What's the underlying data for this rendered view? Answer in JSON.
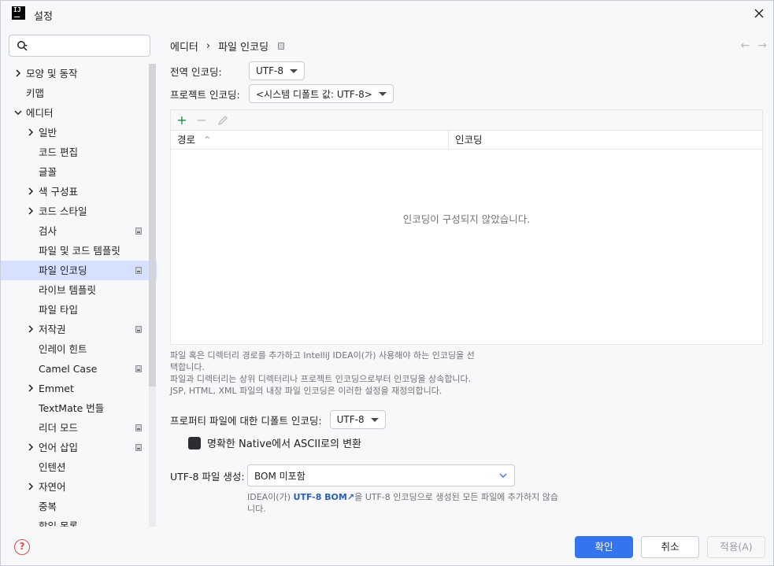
{
  "window": {
    "title": "설정"
  },
  "search": {
    "placeholder": ""
  },
  "sidebar": {
    "items": [
      {
        "label": "모양 및 동작",
        "chevron": "right",
        "indent": 0,
        "project": false,
        "selected": false
      },
      {
        "label": "키맵",
        "chevron": "",
        "indent": 0,
        "project": false,
        "selected": false
      },
      {
        "label": "에디터",
        "chevron": "down",
        "indent": 0,
        "project": false,
        "selected": false
      },
      {
        "label": "일반",
        "chevron": "right",
        "indent": 1,
        "project": false,
        "selected": false
      },
      {
        "label": "코드 편집",
        "chevron": "",
        "indent": 1,
        "project": false,
        "selected": false
      },
      {
        "label": "글꼴",
        "chevron": "",
        "indent": 1,
        "project": false,
        "selected": false
      },
      {
        "label": "색 구성표",
        "chevron": "right",
        "indent": 1,
        "project": false,
        "selected": false
      },
      {
        "label": "코드 스타일",
        "chevron": "right",
        "indent": 1,
        "project": false,
        "selected": false
      },
      {
        "label": "검사",
        "chevron": "",
        "indent": 1,
        "project": true,
        "selected": false
      },
      {
        "label": "파일 및 코드 템플릿",
        "chevron": "",
        "indent": 1,
        "project": false,
        "selected": false
      },
      {
        "label": "파일 인코딩",
        "chevron": "",
        "indent": 1,
        "project": true,
        "selected": true
      },
      {
        "label": "라이브 템플릿",
        "chevron": "",
        "indent": 1,
        "project": false,
        "selected": false
      },
      {
        "label": "파일 타입",
        "chevron": "",
        "indent": 1,
        "project": false,
        "selected": false
      },
      {
        "label": "저작권",
        "chevron": "right",
        "indent": 1,
        "project": true,
        "selected": false
      },
      {
        "label": "인레이 힌트",
        "chevron": "",
        "indent": 1,
        "project": false,
        "selected": false
      },
      {
        "label": "Camel Case",
        "chevron": "",
        "indent": 1,
        "project": true,
        "selected": false
      },
      {
        "label": "Emmet",
        "chevron": "right",
        "indent": 1,
        "project": false,
        "selected": false
      },
      {
        "label": "TextMate 번들",
        "chevron": "",
        "indent": 1,
        "project": false,
        "selected": false
      },
      {
        "label": "리더 모드",
        "chevron": "",
        "indent": 1,
        "project": true,
        "selected": false
      },
      {
        "label": "언어 삽입",
        "chevron": "right",
        "indent": 1,
        "project": true,
        "selected": false
      },
      {
        "label": "인텐션",
        "chevron": "",
        "indent": 1,
        "project": false,
        "selected": false
      },
      {
        "label": "자연어",
        "chevron": "right",
        "indent": 1,
        "project": false,
        "selected": false
      },
      {
        "label": "중복",
        "chevron": "",
        "indent": 1,
        "project": false,
        "selected": false
      },
      {
        "label": "할일 목록",
        "chevron": "",
        "indent": 1,
        "project": false,
        "selected": false
      }
    ]
  },
  "breadcrumb": {
    "parent": "에디터",
    "current": "파일 인코딩"
  },
  "global_encoding": {
    "label": "전역 인코딩:",
    "value": "UTF-8"
  },
  "project_encoding": {
    "label": "프로젝트 인코딩:",
    "value": "<시스템 디폴트 값: UTF-8>"
  },
  "table": {
    "col_path": "경로",
    "col_encoding": "인코딩",
    "empty_text": "인코딩이 구성되지 않았습니다."
  },
  "hint": {
    "line1": "파일 혹은 디렉터리 경로를 추가하고 IntelliJ IDEA이(가) 사용해야 하는 인코딩을 선",
    "line2": "택합니다.",
    "line3": "파일과 디렉터리는 상위 디렉터리나 프로젝트 인코딩으로부터 인코딩을 상속합니다.",
    "line4": "JSP, HTML, XML 파일의 내장 파일 인코딩은 이러한 설정을 재정의합니다."
  },
  "properties": {
    "label": "프로퍼티 파일에 대한 디폴트 인코딩:",
    "value": "UTF-8"
  },
  "native_ascii": {
    "label": "명확한 Native에서 ASCII로의 변환",
    "checked": true
  },
  "bom": {
    "label": "UTF-8 파일 생성:",
    "value": "BOM 미포함",
    "info_pre": "IDEA이(가)",
    "info_link": "UTF-8 BOM",
    "info_post": "을 UTF-8 인코딩으로 생성된 모든 파일에 추가하지 않습",
    "info_line2": "니다."
  },
  "footer": {
    "ok": "확인",
    "cancel": "취소",
    "apply": "적용(A)",
    "help": "?"
  },
  "colors": {
    "accent": "#3574f0",
    "selection": "#d5e1ff",
    "link": "#2f5fb6",
    "help": "#d74e52"
  }
}
